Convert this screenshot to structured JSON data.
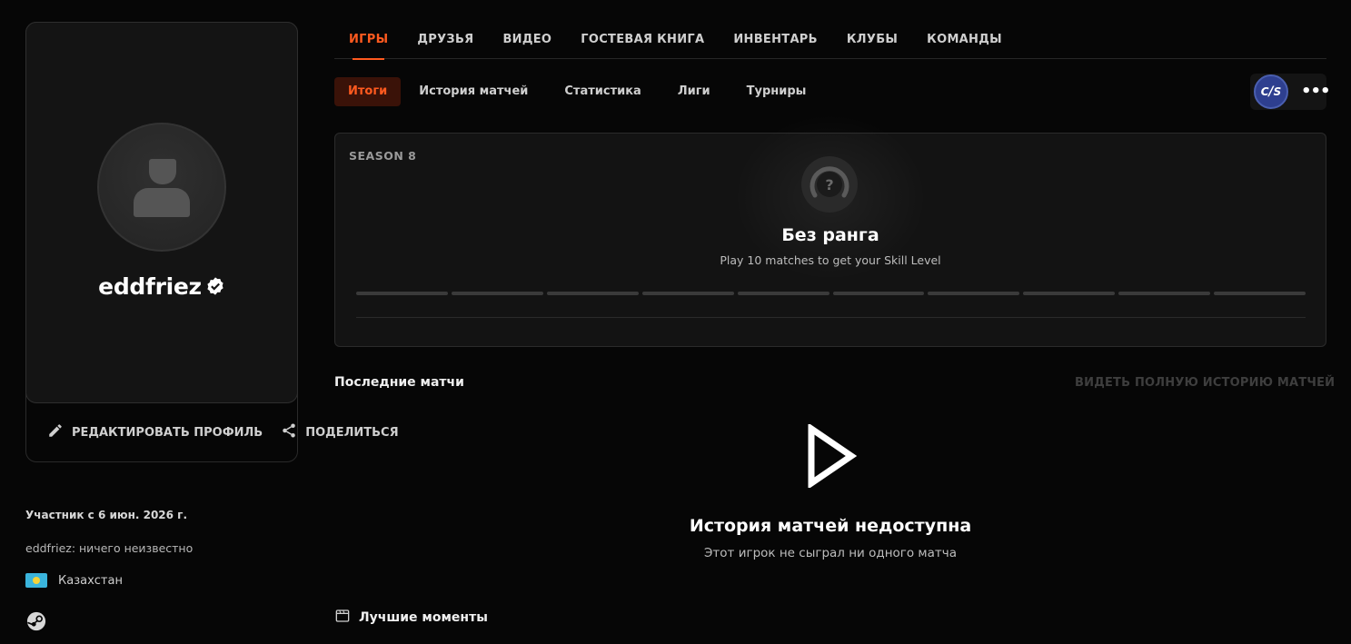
{
  "profile": {
    "username": "eddfriez",
    "edit_label": "РЕДАКТИРОВАТЬ ПРОФИЛЬ",
    "share_label": "ПОДЕЛИТЬСЯ",
    "member_since": "Участник с 6 июн. 2026 г.",
    "bio": "eddfriez: ничего неизвестно",
    "country": "Казахстан",
    "verified_color": "#ffffff"
  },
  "main_tabs": [
    {
      "label": "ИГРЫ",
      "active": true
    },
    {
      "label": "ДРУЗЬЯ"
    },
    {
      "label": "ВИДЕО"
    },
    {
      "label": "ГОСТЕВАЯ КНИГА"
    },
    {
      "label": "ИНВЕНТАРЬ"
    },
    {
      "label": "КЛУБЫ"
    },
    {
      "label": "КОМАНДЫ"
    }
  ],
  "sub_tabs": [
    {
      "label": "Итоги",
      "active": true
    },
    {
      "label": "История матчей"
    },
    {
      "label": "Статистика"
    },
    {
      "label": "Лиги"
    },
    {
      "label": "Турниры"
    }
  ],
  "game_switch": {
    "game": "CS",
    "more": "•••"
  },
  "season": {
    "label": "SEASON 8",
    "rank": "Без ранга",
    "hint": "Play 10 matches to get your Skill Level",
    "rank_icon_glyph": "?",
    "level_segments": 10,
    "levels_filled": 0
  },
  "recent_matches": {
    "title": "Последние матчи",
    "full_history_link": "ВИДЕТЬ ПОЛНУЮ ИСТОРИЮ МАТЧЕЙ",
    "empty_title": "История матчей недоступна",
    "empty_subtitle": "Этот игрок не сыграл ни одного матча"
  },
  "highlights": {
    "title": "Лучшие моменты"
  },
  "colors": {
    "accent": "#ff5a1f",
    "accent_bg": "#3a1208",
    "background": "#060606",
    "panel": "#131313"
  }
}
